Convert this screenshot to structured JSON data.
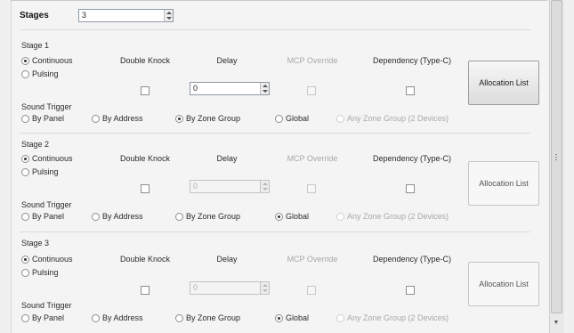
{
  "stages_label": "Stages",
  "stages_value": "3",
  "stages": [
    {
      "title": "Stage 1",
      "mode_options": [
        "Continuous",
        "Pulsing"
      ],
      "mode_selected": "Continuous",
      "col_double_knock": "Double Knock",
      "col_delay": "Delay",
      "col_mcp_override": "MCP Override",
      "col_dependency": "Dependency (Type-C)",
      "delay_value": "0",
      "allocation_label": "Allocation List",
      "sound_trigger_label": "Sound Trigger",
      "trigger_options": [
        "By Panel",
        "By Address",
        "By Zone Group",
        "Global",
        "Any Zone Group (2 Devices)"
      ],
      "trigger_selected": "By Zone Group"
    },
    {
      "title": "Stage 2",
      "mode_options": [
        "Continuous",
        "Pulsing"
      ],
      "mode_selected": "Continuous",
      "col_double_knock": "Double Knock",
      "col_delay": "Delay",
      "col_mcp_override": "MCP Override",
      "col_dependency": "Dependency (Type-C)",
      "delay_value": "0",
      "allocation_label": "Allocation List",
      "sound_trigger_label": "Sound Trigger",
      "trigger_options": [
        "By Panel",
        "By Address",
        "By Zone Group",
        "Global",
        "Any Zone Group (2 Devices)"
      ],
      "trigger_selected": "Global"
    },
    {
      "title": "Stage 3",
      "mode_options": [
        "Continuous",
        "Pulsing"
      ],
      "mode_selected": "Continuous",
      "col_double_knock": "Double Knock",
      "col_delay": "Delay",
      "col_mcp_override": "MCP Override",
      "col_dependency": "Dependency (Type-C)",
      "delay_value": "0",
      "allocation_label": "Allocation List",
      "sound_trigger_label": "Sound Trigger",
      "trigger_options": [
        "By Panel",
        "By Address",
        "By Zone Group",
        "Global",
        "Any Zone Group (2 Devices)"
      ],
      "trigger_selected": "Global"
    }
  ]
}
